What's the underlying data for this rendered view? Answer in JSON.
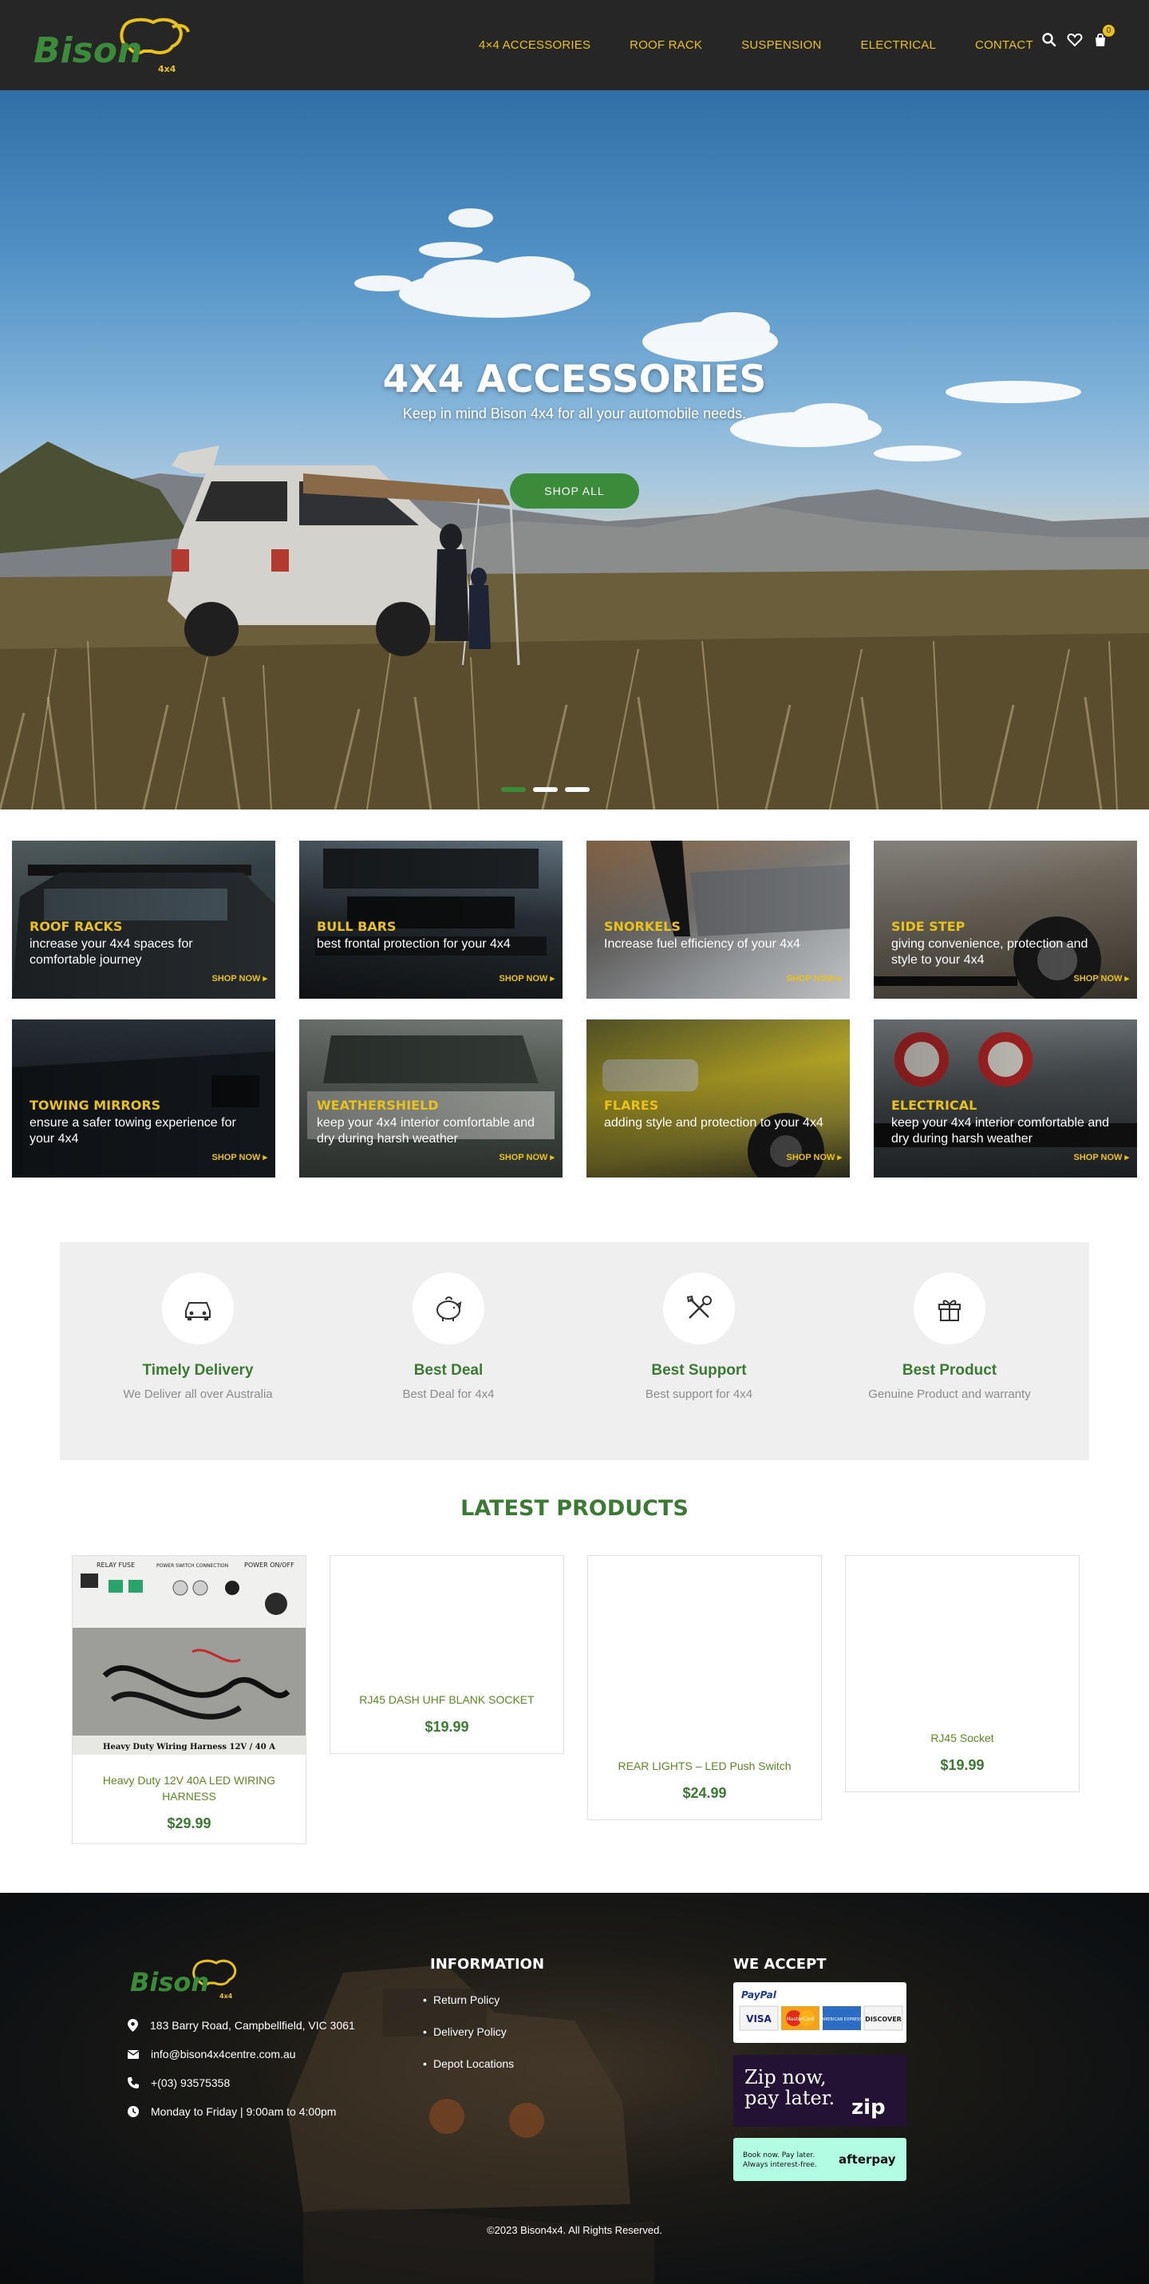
{
  "brand": {
    "name": "Bison",
    "suffix": "4x4",
    "color_green": "#3b8b3b",
    "color_yellow": "#e8c21a"
  },
  "nav": {
    "items": [
      "4×4 ACCESSORIES",
      "ROOF RACK",
      "SUSPENSION",
      "ELECTRICAL",
      "CONTACT"
    ],
    "icons": [
      "search-icon",
      "heart-icon",
      "shopping-bag-icon"
    ],
    "cart_count": "0"
  },
  "hero": {
    "title": "4X4 ACCESSORIES",
    "subtitle": "Keep in mind Bison 4x4 for all your automobile needs.",
    "button": "SHOP ALL",
    "slides": 3,
    "active_slide": 1
  },
  "categories": [
    {
      "title": "ROOF RACKS",
      "desc": "increase your 4x4 spaces for comfortable journey",
      "shop": "SHOP NOW ▸"
    },
    {
      "title": "BULL BARS",
      "desc": "best frontal protection for your 4x4",
      "shop": "SHOP NOW ▸"
    },
    {
      "title": "SNORKELS",
      "desc": "Increase fuel efficiency of your 4x4",
      "shop": "SHOP NOW ▸"
    },
    {
      "title": "SIDE STEP",
      "desc": "giving convenience, protection and style to your 4x4",
      "shop": "SHOP NOW ▸"
    },
    {
      "title": "TOWING MIRRORS",
      "desc": "ensure a safer towing experience for your 4x4",
      "shop": "SHOP NOW ▸"
    },
    {
      "title": "WEATHERSHIELD",
      "desc": "keep your 4x4 interior comfortable and dry during harsh weather",
      "shop": "SHOP NOW ▸"
    },
    {
      "title": "FLARES",
      "desc": "adding style and protection to your 4x4",
      "shop": "SHOP NOW ▸"
    },
    {
      "title": "ELECTRICAL",
      "desc": "keep your 4x4 interior comfortable and dry during harsh weather",
      "shop": "SHOP NOW ▸"
    }
  ],
  "features": [
    {
      "icon": "car-icon",
      "title": "Timely Delivery",
      "sub": "We Deliver all over Australia"
    },
    {
      "icon": "piggy-bank-icon",
      "title": "Best Deal",
      "sub": "Best Deal for 4x4"
    },
    {
      "icon": "tools-icon",
      "title": "Best Support",
      "sub": "Best support for 4x4"
    },
    {
      "icon": "gift-icon",
      "title": "Best Product",
      "sub": "Genuine Product and warranty"
    }
  ],
  "products": {
    "title": "LATEST PRODUCTS",
    "items": [
      {
        "name": "Heavy Duty 12V 40A LED WIRING HARNESS",
        "price": "$29.99",
        "image_labels": {
          "relay": "RELAY FUSE",
          "power": "POWER SWITCH CONNECTION",
          "onoff": "POWER ON/OFF",
          "caption": "Heavy Duty Wiring Harness 12V / 40 A"
        }
      },
      {
        "name": "RJ45 DASH UHF BLANK SOCKET",
        "price": "$19.99"
      },
      {
        "name": "REAR LIGHTS – LED Push Switch",
        "price": "$24.99"
      },
      {
        "name": "RJ45 Socket",
        "price": "$19.99"
      }
    ]
  },
  "footer": {
    "address": "183 Barry Road, Campbellfield, VIC 3061",
    "email": "info@bison4x4centre.com.au",
    "phone": "+(03) 93575358",
    "hours": "Monday to Friday | 9:00am to 4:00pm",
    "info_heading": "INFORMATION",
    "links": [
      "Return Policy",
      "Delivery Policy",
      "Depot Locations"
    ],
    "accept_heading": "WE ACCEPT",
    "payments": {
      "paypal": "PayPal",
      "cards": [
        "VISA",
        "MasterCard",
        "AMERICAN EXPRESS",
        "DISCOVER"
      ],
      "zip_line1": "Zip now,",
      "zip_line2": "pay later.",
      "zip_brand": "zip",
      "afterpay_line1": "Book now. Pay later.",
      "afterpay_line2": "Always interest-free.",
      "afterpay_brand": "afterpay"
    },
    "copyright": "©2023 Bison4x4. All Rights Reserved."
  }
}
